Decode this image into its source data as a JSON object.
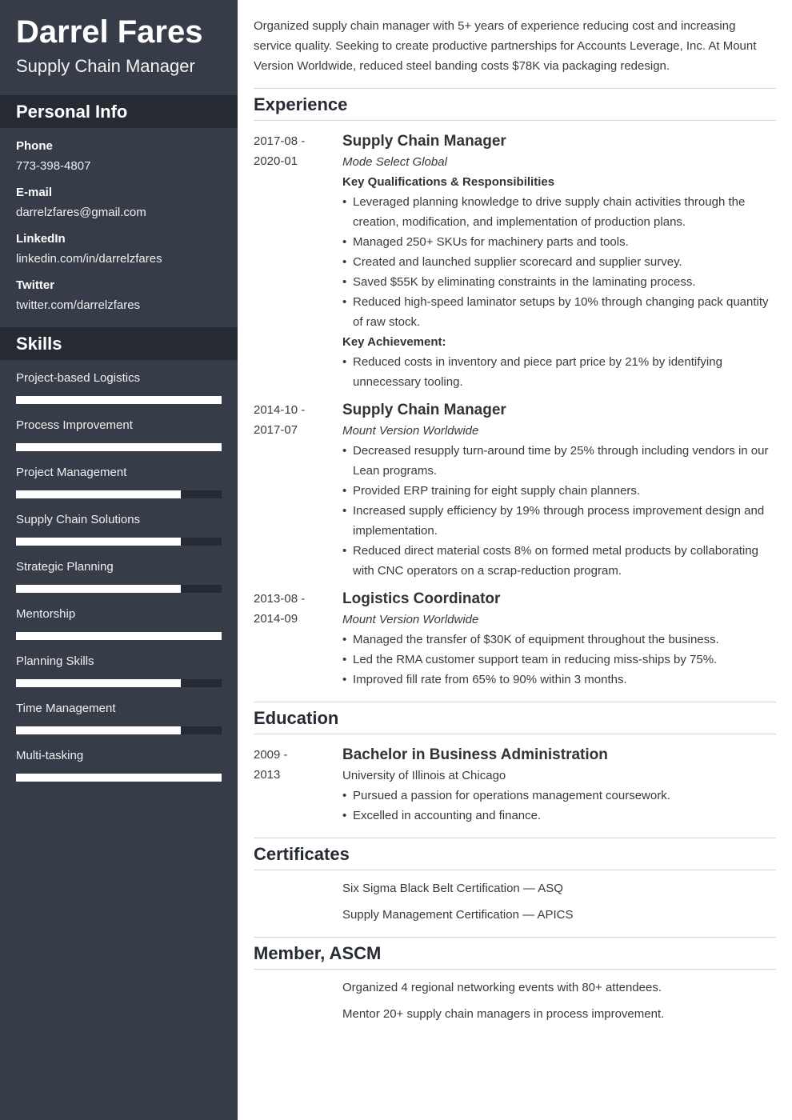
{
  "profile": {
    "name": "Darrel Fares",
    "title": "Supply Chain Manager"
  },
  "sidebar": {
    "personal_info_heading": "Personal Info",
    "contacts": [
      {
        "label": "Phone",
        "value": "773-398-4807"
      },
      {
        "label": "E-mail",
        "value": "darrelzfares@gmail.com"
      },
      {
        "label": "LinkedIn",
        "value": "linkedin.com/in/darrelzfares"
      },
      {
        "label": "Twitter",
        "value": "twitter.com/darrelzfares"
      }
    ],
    "skills_heading": "Skills",
    "skills": [
      {
        "name": "Project-based Logistics",
        "level": 1.0
      },
      {
        "name": "Process Improvement",
        "level": 1.0
      },
      {
        "name": "Project Management",
        "level": 0.8
      },
      {
        "name": "Supply Chain Solutions",
        "level": 0.8
      },
      {
        "name": "Strategic Planning",
        "level": 0.8
      },
      {
        "name": "Mentorship",
        "level": 1.0
      },
      {
        "name": "Planning Skills",
        "level": 0.8
      },
      {
        "name": "Time Management",
        "level": 0.8
      },
      {
        "name": "Multi-tasking",
        "level": 1.0
      }
    ]
  },
  "summary": "Organized supply chain manager with 5+ years of experience reducing cost and increasing service quality. Seeking to create productive partnerships for Accounts Leverage, Inc. At Mount Version Worldwide, reduced steel banding costs $78K via packaging redesign.",
  "experience": {
    "heading": "Experience",
    "jobs": [
      {
        "date_start": "2017-08 -",
        "date_end": "2020-01",
        "title": "Supply Chain Manager",
        "company": "Mode Select Global",
        "qual_heading": "Key Qualifications & Responsibilities",
        "bullets": [
          "Leveraged planning knowledge to drive supply chain activities through the creation, modification, and implementation of production plans.",
          "Managed 250+ SKUs for machinery parts and tools.",
          "Created and launched supplier scorecard and supplier survey.",
          "Saved $55K by eliminating constraints in the laminating process.",
          "Reduced high-speed laminator setups by 10% through changing pack quantity of raw stock."
        ],
        "achievement_heading": "Key Achievement:",
        "achievements": [
          "Reduced costs in inventory and piece part price by 21% by identifying unnecessary tooling."
        ]
      },
      {
        "date_start": "2014-10 -",
        "date_end": "2017-07",
        "title": "Supply Chain Manager",
        "company": "Mount Version Worldwide",
        "bullets": [
          "Decreased resupply turn-around time by 25% through including vendors in our Lean programs.",
          "Provided ERP training for eight supply chain planners.",
          "Increased supply efficiency by 19% through process improvement design and implementation.",
          "Reduced direct material costs 8% on formed metal products by collaborating with CNC operators on a scrap-reduction program."
        ]
      },
      {
        "date_start": "2013-08 -",
        "date_end": "2014-09",
        "title": "Logistics Coordinator",
        "company": "Mount Version Worldwide",
        "bullets": [
          "Managed the transfer of $30K of equipment throughout the business.",
          "Led the RMA customer support team in reducing miss-ships by 75%.",
          "Improved fill rate from 65% to 90% within 3 months."
        ]
      }
    ]
  },
  "education": {
    "heading": "Education",
    "date_start": "2009 -",
    "date_end": "2013",
    "degree": "Bachelor in Business Administration",
    "school": "University of Illinois at Chicago",
    "bullets": [
      "Pursued a passion for operations management coursework.",
      "Excelled in accounting and finance."
    ]
  },
  "certificates": {
    "heading": "Certificates",
    "items": [
      "Six Sigma Black Belt Certification — ASQ",
      "Supply Management Certification — APICS"
    ]
  },
  "membership": {
    "heading": "Member, ASCM",
    "items": [
      "Organized 4 regional networking events with 80+ attendees.",
      "Mentor 20+ supply chain managers in process improvement."
    ]
  }
}
